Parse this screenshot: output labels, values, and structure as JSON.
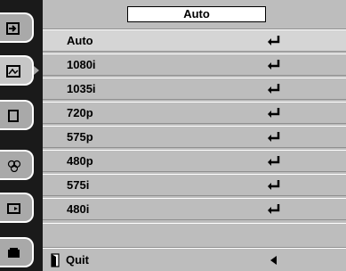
{
  "sidebar": {
    "items": [
      {
        "name": "input-icon"
      },
      {
        "name": "image-adjust-icon"
      },
      {
        "name": "screen-icon"
      },
      {
        "name": "color-icon"
      },
      {
        "name": "setting-icon"
      },
      {
        "name": "info-icon"
      }
    ]
  },
  "menu": {
    "current_value": "Auto",
    "items": [
      {
        "label": "Auto"
      },
      {
        "label": "1080i"
      },
      {
        "label": "1035i"
      },
      {
        "label": "720p"
      },
      {
        "label": "575p"
      },
      {
        "label": "480p"
      },
      {
        "label": "575i"
      },
      {
        "label": "480i"
      }
    ],
    "quit_label": "Quit"
  },
  "colors": {
    "menu_bg": "#bdbdbd",
    "selected_bg": "#d5d5d5",
    "sidebar_bg": "#1a1a1a",
    "tab_bg": "#a9a9a9"
  }
}
